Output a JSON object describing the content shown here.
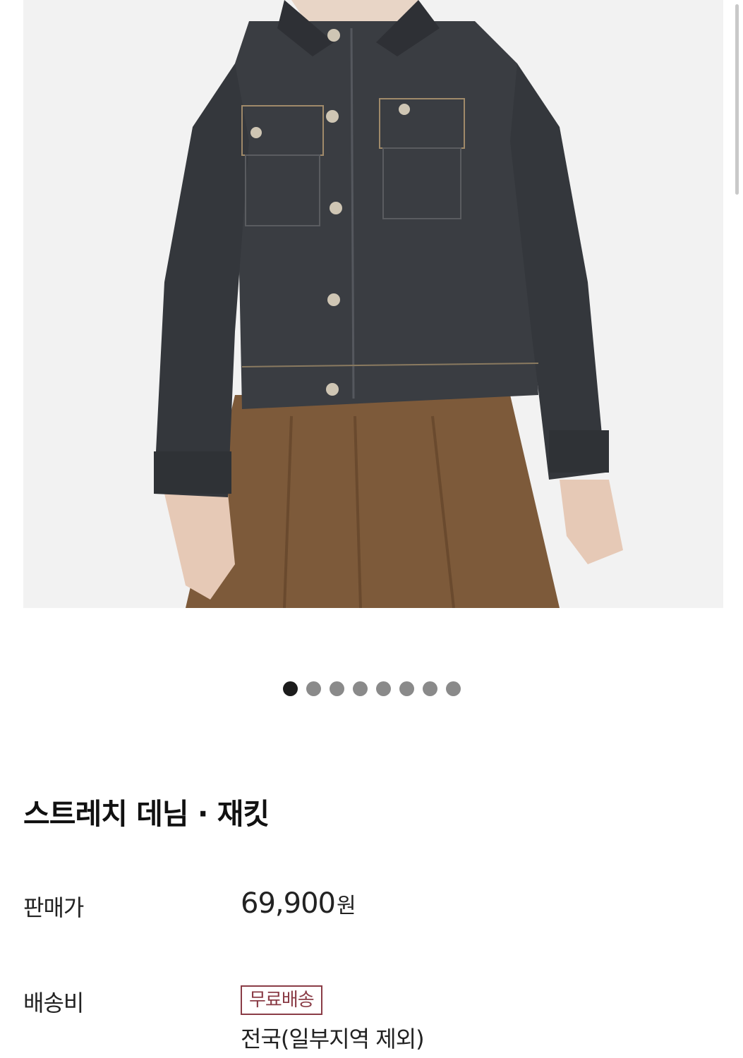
{
  "product": {
    "title": "스트레치 데님 · 재킷",
    "image_description_icon": "product-photo-denim-jacket"
  },
  "carousel": {
    "total": 8,
    "active_index": 0
  },
  "price": {
    "label": "판매가",
    "amount": "69,900",
    "currency": "원"
  },
  "shipping": {
    "label": "배송비",
    "badge": "무료배송",
    "note": "전국(일부지역 제외)"
  },
  "colors": {
    "badge": "#8a3c46",
    "dot_active": "#1c1c1c",
    "dot_inactive": "#8a8a8a",
    "jacket": "#3a3d42",
    "skirt": "#7d5a3a",
    "background": "#f2f2f2"
  }
}
